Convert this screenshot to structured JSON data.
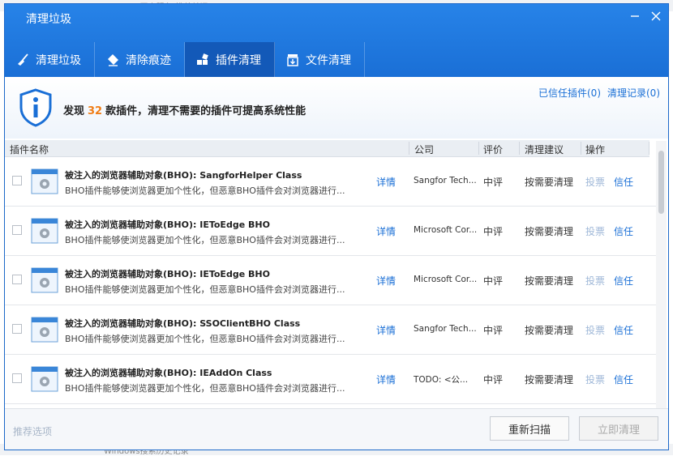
{
  "window": {
    "title": "清理垃圾"
  },
  "background": {
    "top_text": "Windows开启服务(推荐关闭)",
    "bottom_text": "Windows搜索历史记录"
  },
  "tabs": [
    {
      "label": "清理垃圾",
      "icon": "broom-icon"
    },
    {
      "label": "清除痕迹",
      "icon": "eraser-icon"
    },
    {
      "label": "插件清理",
      "icon": "plugin-icon",
      "active": true
    },
    {
      "label": "文件清理",
      "icon": "file-clean-icon"
    }
  ],
  "banner": {
    "prefix": "发现",
    "count": "32",
    "suffix": "款插件，清理不需要的插件可提高系统性能",
    "trusted_link": "已信任插件(0)",
    "history_link": "清理记录(0)"
  },
  "columns": {
    "name": "插件名称",
    "company": "公司",
    "rating": "评价",
    "advice": "清理建议",
    "action": "操作"
  },
  "rows": [
    {
      "name": "被注入的浏览器辅助对象(BHO): SangforHelper Class",
      "desc": "BHO插件能够使浏览器更加个性化，但恶意BHO插件会对浏览器进行...",
      "detail": "详情",
      "company": "Sangfor Tech...",
      "rating": "中评",
      "advice": "按需要清理",
      "complain": "投票",
      "trust": "信任"
    },
    {
      "name": "被注入的浏览器辅助对象(BHO): IEToEdge BHO",
      "desc": "BHO插件能够使浏览器更加个性化，但恶意BHO插件会对浏览器进行...",
      "detail": "详情",
      "company": "Microsoft Cor...",
      "rating": "中评",
      "advice": "按需要清理",
      "complain": "投票",
      "trust": "信任"
    },
    {
      "name": "被注入的浏览器辅助对象(BHO): IEToEdge BHO",
      "desc": "BHO插件能够使浏览器更加个性化，但恶意BHO插件会对浏览器进行...",
      "detail": "详情",
      "company": "Microsoft Cor...",
      "rating": "中评",
      "advice": "按需要清理",
      "complain": "投票",
      "trust": "信任"
    },
    {
      "name": "被注入的浏览器辅助对象(BHO): SSOClientBHO Class",
      "desc": "BHO插件能够使浏览器更加个性化，但恶意BHO插件会对浏览器进行...",
      "detail": "详情",
      "company": "Sangfor Tech...",
      "rating": "中评",
      "advice": "按需要清理",
      "complain": "投票",
      "trust": "信任"
    },
    {
      "name": "被注入的浏览器辅助对象(BHO): IEAddOn Class",
      "desc": "BHO插件能够使浏览器更加个性化，但恶意BHO插件会对浏览器进行...",
      "detail": "详情",
      "company": "TODO: <公...",
      "rating": "中评",
      "advice": "按需要清理",
      "complain": "投票",
      "trust": "信任"
    }
  ],
  "footer": {
    "recommend": "推荐选项",
    "rescan": "重新扫描",
    "clean_now": "立即清理"
  },
  "colors": {
    "title_blue": "#1a6fd6",
    "active_tab": "#1359b8",
    "count_orange": "#f07d16",
    "link_blue": "#1a6fd6"
  }
}
